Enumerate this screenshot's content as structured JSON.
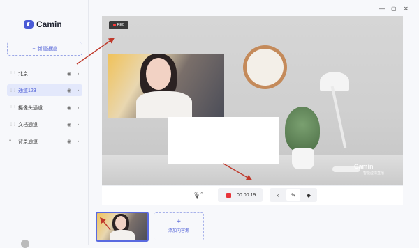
{
  "app": {
    "name": "Camin"
  },
  "sidebar": {
    "new_channel": "新建通道",
    "items": [
      {
        "label": "北京",
        "active": false,
        "locked": false
      },
      {
        "label": "通道123",
        "active": true,
        "locked": false
      },
      {
        "label": "摄像头通道",
        "active": false,
        "locked": false
      },
      {
        "label": "文档通道",
        "active": false,
        "locked": false
      },
      {
        "label": "背景通道",
        "active": false,
        "locked": true
      }
    ]
  },
  "window_controls": {
    "minimize": "—",
    "maximize": "▢",
    "close": "✕"
  },
  "preview": {
    "rec_badge": "REC",
    "watermark": "Camin",
    "watermark_sub": "智能虚拟直播"
  },
  "controls": {
    "timer": "00:00:19",
    "mic_icon": "microphone-icon",
    "tools": [
      "chevron-left-icon",
      "pen-icon",
      "eraser-icon"
    ]
  },
  "sources": {
    "add_label": "添加内容源"
  },
  "colors": {
    "accent": "#4a5bd6",
    "record_red": "#e8343a",
    "arrow_red": "#c0392b"
  }
}
